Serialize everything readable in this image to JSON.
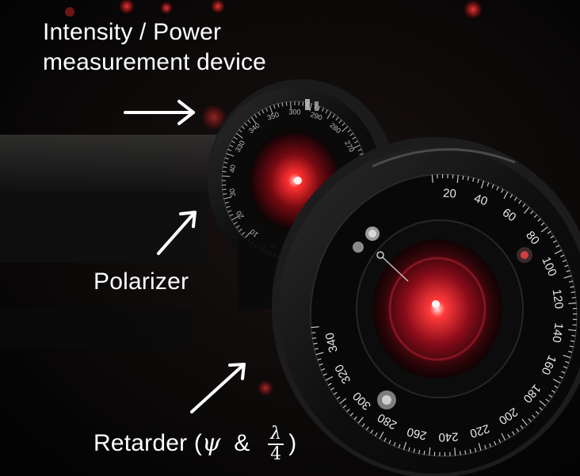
{
  "labels": {
    "device_line1": "Intensity / Power",
    "device_line2": "measurement device",
    "polarizer": "Polarizer",
    "retarder_prefix": "Retarder (",
    "psi": "ψ",
    "amp": "&",
    "lambda": "λ",
    "four": "4",
    "retarder_suffix": ")"
  },
  "back_dial_numbers": [
    "0",
    "10",
    "20",
    "30",
    "40",
    "330",
    "340",
    "350",
    "300",
    "290",
    "280",
    "270"
  ],
  "front_dial_numbers": [
    "20",
    "40",
    "60",
    "80",
    "100",
    "120",
    "140",
    "160",
    "180",
    "200",
    "220",
    "240",
    "260",
    "280",
    "300",
    "320",
    "340"
  ],
  "colors": {
    "background": "#050404",
    "laser": "#ff2a2a",
    "mount_metal": "#121212",
    "dial_text": "#e8e8e8",
    "arrow": "#ffffff"
  }
}
